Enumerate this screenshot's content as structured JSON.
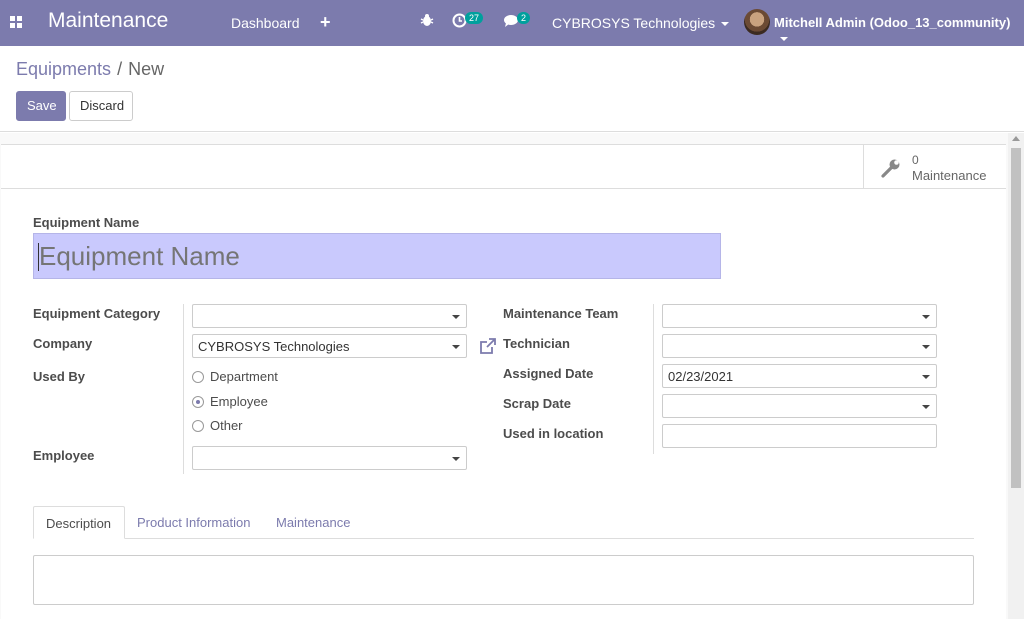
{
  "navbar": {
    "app_title": "Maintenance",
    "menu": {
      "dashboard": "Dashboard"
    },
    "activity_count": "27",
    "message_count": "2",
    "company": "CYBROSYS Technologies",
    "user": "Mitchell Admin (Odoo_13_community)",
    "icons": {
      "apps": "apps-grid-icon",
      "plus": "plus-icon",
      "debug": "bug-icon",
      "activity": "clock-icon",
      "messages": "chat-icon"
    },
    "color": "#7c7bad"
  },
  "breadcrumb": {
    "parent": "Equipments",
    "separator": "/",
    "current": "New"
  },
  "actions": {
    "save": "Save",
    "discard": "Discard"
  },
  "smart_button": {
    "value": "0",
    "label": "Maintenance",
    "icon": "wrench-icon"
  },
  "form": {
    "name_label": "Equipment Name",
    "name_placeholder": "Equipment Name",
    "left": {
      "category_label": "Equipment Category",
      "category_value": "",
      "company_label": "Company",
      "company_value": "CYBROSYS Technologies",
      "used_by_label": "Used By",
      "used_by_options": [
        "Department",
        "Employee",
        "Other"
      ],
      "used_by_selected": "Employee",
      "employee_label": "Employee",
      "employee_value": ""
    },
    "right": {
      "team_label": "Maintenance Team",
      "team_value": "",
      "technician_label": "Technician",
      "technician_value": "",
      "assigned_date_label": "Assigned Date",
      "assigned_date_value": "02/23/2021",
      "scrap_date_label": "Scrap Date",
      "scrap_date_value": "",
      "location_label": "Used in location",
      "location_value": ""
    }
  },
  "tabs": [
    "Description",
    "Product Information",
    "Maintenance"
  ],
  "active_tab": "Description"
}
